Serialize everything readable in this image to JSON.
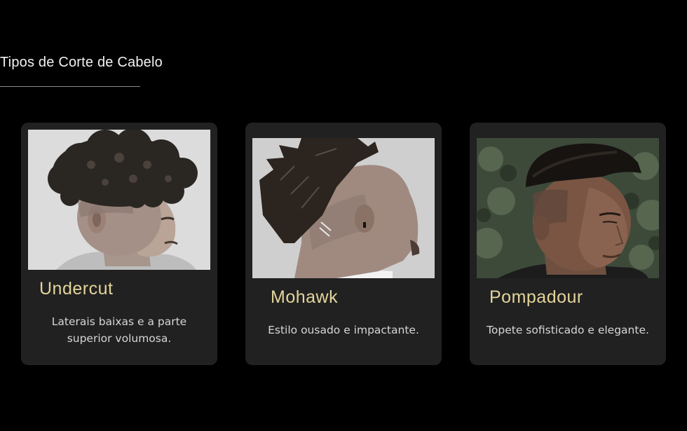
{
  "section": {
    "title": "Tipos de Corte de Cabelo"
  },
  "cards": [
    {
      "name": "Undercut",
      "description": "Laterais baixas e a parte superior volumosa.",
      "photo_icon": "curly-undercut-portrait"
    },
    {
      "name": "Mohawk",
      "description": "Estilo ousado e impactante.",
      "photo_icon": "mohawk-rear-profile"
    },
    {
      "name": "Pompadour",
      "description": "Topete sofisticado e elegante.",
      "photo_icon": "pompadour-portrait"
    }
  ],
  "colors": {
    "background": "#000000",
    "card_background": "#212121",
    "card_title": "#e3d49a",
    "card_text": "#d6d6d6",
    "section_title": "#f2f2f2"
  }
}
